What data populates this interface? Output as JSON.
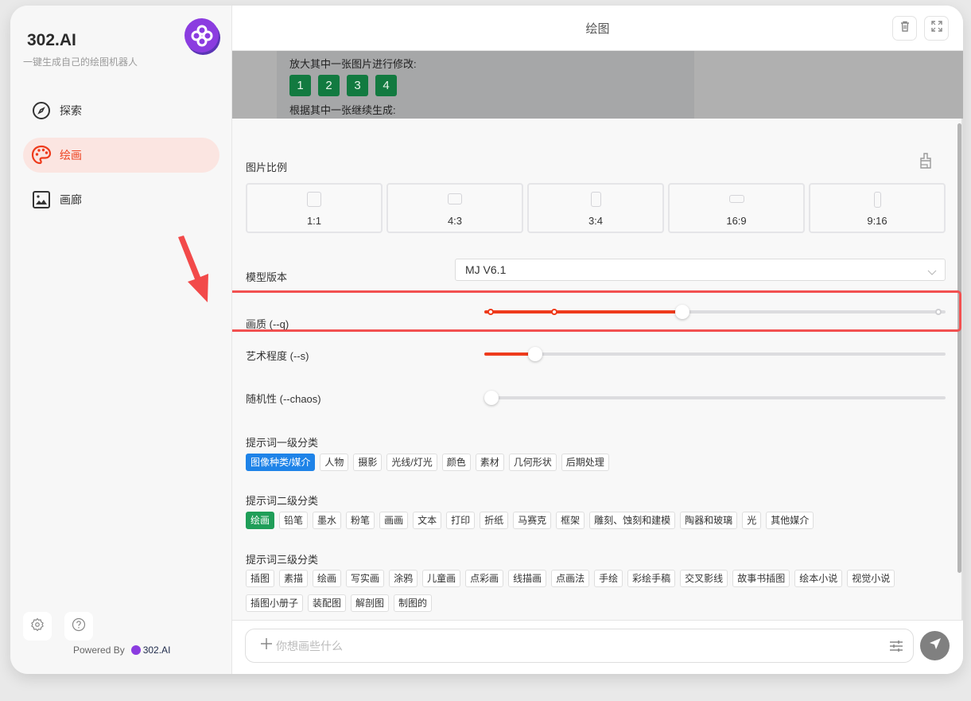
{
  "sidebar": {
    "brand_title": "302.AI",
    "brand_subtitle": "一键生成自己的绘图机器人",
    "items": [
      {
        "label": "探索",
        "icon": "compass-icon",
        "active": false
      },
      {
        "label": "绘画",
        "icon": "palette-icon",
        "active": true
      },
      {
        "label": "画廊",
        "icon": "image-icon",
        "active": false
      }
    ],
    "footer": {
      "settings_icon": "gear-icon",
      "help_icon": "question-icon",
      "powered_by": "Powered By",
      "powered_brand": "302.AI"
    }
  },
  "header": {
    "title": "绘图",
    "delete_icon": "trash-icon",
    "fullscreen_icon": "expand-icon"
  },
  "preview": {
    "upscale_text": "放大其中一张图片进行修改:",
    "upscale_buttons": [
      "1",
      "2",
      "3",
      "4"
    ],
    "variation_text": "根据其中一张继续生成:"
  },
  "form": {
    "aspect_ratio": {
      "label": "图片比例",
      "options": [
        "1:1",
        "4:3",
        "3:4",
        "16:9",
        "9:16"
      ]
    },
    "model": {
      "label": "模型版本",
      "value": "MJ V6.1"
    },
    "quality": {
      "label": "画质   (--q)",
      "value_fraction": 0.43,
      "marks": [
        0.014,
        0.152,
        0.985
      ]
    },
    "stylize": {
      "label": "艺术程度   (--s)",
      "value_fraction": 0.11
    },
    "chaos": {
      "label": "随机性   (--chaos)",
      "value_fraction": 0.0
    },
    "category_level1": {
      "label": "提示词一级分类",
      "tags": [
        "图像种类/媒介",
        "人物",
        "摄影",
        "光线/灯光",
        "颜色",
        "素材",
        "几何形状",
        "后期处理"
      ],
      "selected": 0
    },
    "category_level2": {
      "label": "提示词二级分类",
      "tags": [
        "绘画",
        "铅笔",
        "墨水",
        "粉笔",
        "画画",
        "文本",
        "打印",
        "折纸",
        "马赛克",
        "框架",
        "雕刻、蚀刻和建模",
        "陶器和玻璃",
        "光",
        "其他媒介"
      ],
      "selected": 0
    },
    "category_level3": {
      "label": "提示词三级分类",
      "tags": [
        "插图",
        "素描",
        "绘画",
        "写实画",
        "涂鸦",
        "儿童画",
        "点彩画",
        "线描画",
        "点画法",
        "手绘",
        "彩绘手稿",
        "交叉影线",
        "故事书插图",
        "绘本小说",
        "视觉小说",
        "插图小册子",
        "装配图",
        "解剖图",
        "制图的"
      ]
    }
  },
  "prompt": {
    "placeholder": "你想画些什么",
    "value": ""
  },
  "colors": {
    "accent": "#ee3b1c",
    "active_nav_bg": "#fbe5e1",
    "level1_active": "#1e83e8",
    "level2_active": "#1f9e58",
    "upscale_button": "#127a40",
    "highlight": "#f25050",
    "brand_purple": "#8b3ce0"
  }
}
